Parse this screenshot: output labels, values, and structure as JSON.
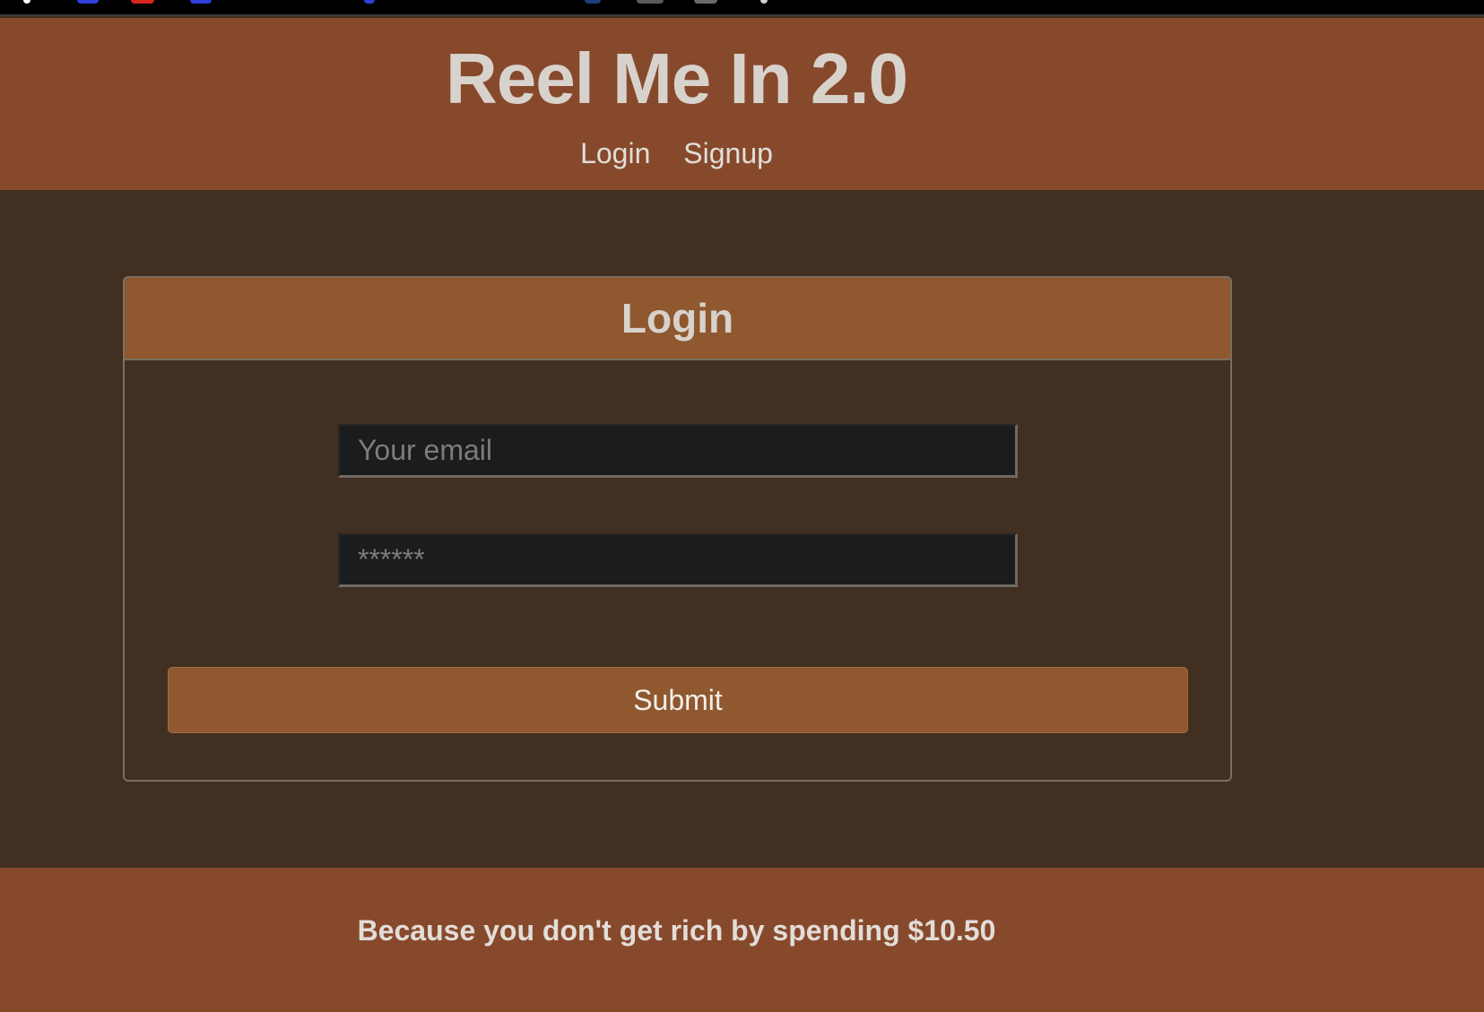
{
  "header": {
    "title": "Reel Me In 2.0",
    "nav": [
      {
        "label": "Login"
      },
      {
        "label": "Signup"
      }
    ]
  },
  "login_card": {
    "title": "Login",
    "email": {
      "placeholder": "Your email",
      "value": ""
    },
    "password": {
      "placeholder": "******",
      "value": ""
    },
    "submit_label": "Submit"
  },
  "footer": {
    "tagline": "Because you don't get rich by spending $10.50"
  },
  "colors": {
    "header_bg": "#87492c",
    "page_bg": "#412f21",
    "card_header_bg": "#8f582f",
    "input_bg": "#1a1c1e",
    "button_bg": "#8f582f",
    "text": "#d8d2cc"
  }
}
